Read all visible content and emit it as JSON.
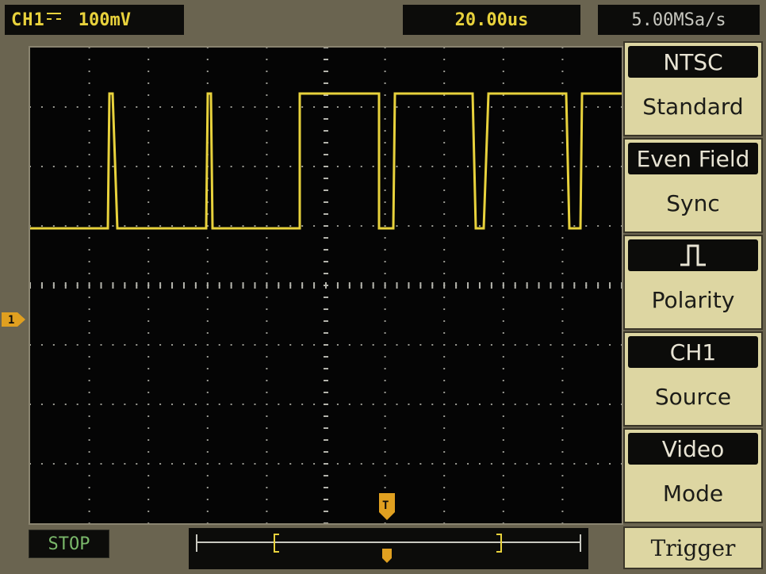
{
  "status_bar": {
    "channel_label": "CH1",
    "volts_per_div": "100mV",
    "time_per_div": "20.00us",
    "sample_rate": "5.00MSa/s"
  },
  "run_status": "STOP",
  "menu": {
    "buttons": [
      {
        "value": "NTSC",
        "title": "Standard"
      },
      {
        "value": "Even Field",
        "title": "Sync"
      },
      {
        "value": "pulse-positive-icon",
        "title": "Polarity"
      },
      {
        "value": "CH1",
        "title": "Source"
      },
      {
        "value": "Video",
        "title": "Mode"
      }
    ],
    "footer_label": "Trigger"
  },
  "channel_marker": "1",
  "trigger_marker": "T",
  "colors": {
    "trace": "#e8d23c",
    "marker": "#e0a020",
    "screen": "#050505",
    "menu_face": "#ddd6a2"
  },
  "chart_data": {
    "type": "line",
    "series": [
      {
        "values": []
      }
    ]
  }
}
